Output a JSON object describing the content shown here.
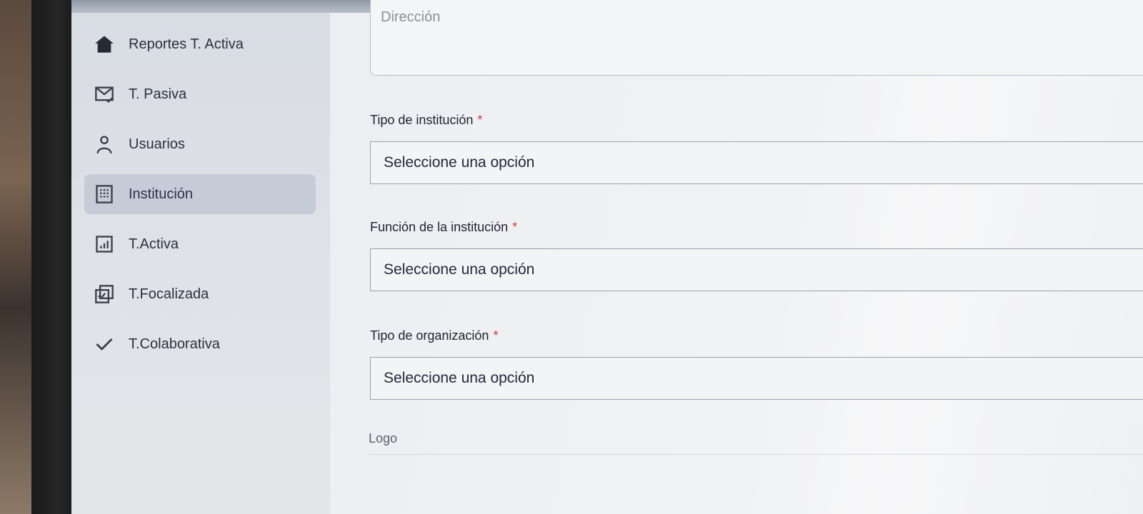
{
  "sidebar": {
    "items": [
      {
        "label": "Reportes T. Activa",
        "icon": "home-icon",
        "active": false
      },
      {
        "label": "T. Pasiva",
        "icon": "mail-check-icon",
        "active": false
      },
      {
        "label": "Usuarios",
        "icon": "user-icon",
        "active": false
      },
      {
        "label": "Institución",
        "icon": "building-icon",
        "active": true
      },
      {
        "label": "T.Activa",
        "icon": "bar-chart-icon",
        "active": false
      },
      {
        "label": "T.Focalizada",
        "icon": "checkbox-stack-icon",
        "active": false
      },
      {
        "label": "T.Colaborativa",
        "icon": "check-icon",
        "active": false
      }
    ]
  },
  "form": {
    "address_placeholder": "Dirección",
    "institution_type": {
      "label": "Tipo de institución",
      "required_mark": "*",
      "value": "Seleccione una opción"
    },
    "institution_function": {
      "label": "Función de la institución",
      "required_mark": "*",
      "value": "Seleccione una opción"
    },
    "organization_type": {
      "label": "Tipo de organización",
      "required_mark": "*",
      "value": "Seleccione una opción"
    },
    "logo_label": "Logo"
  },
  "colors": {
    "active_nav_bg": "#c5ccd8",
    "required_mark": "#d23a3a",
    "text_primary": "#1f2330"
  }
}
